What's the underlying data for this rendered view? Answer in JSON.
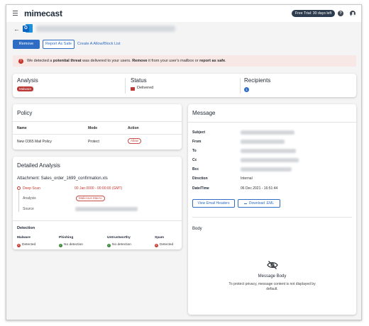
{
  "topbar": {
    "brand": "mimecast",
    "trial_badge": "Free Trial: 30 days left",
    "help_glyph": "?"
  },
  "header": {
    "client_icon": "outlook-icon",
    "outlook_letter": "O"
  },
  "actions": {
    "remove": "Remove",
    "report_safe": "Report As Safe",
    "allow_block": "Create A Allow/Block List"
  },
  "banner": {
    "text_1": "We detected a ",
    "text_2": "potential threat",
    "text_3": " was delivered to your users. ",
    "text_4": "Remove",
    "text_5": " it from your user's mailbox or ",
    "text_6": "report as safe",
    "text_7": "."
  },
  "summary": {
    "analysis_label": "Analysis",
    "analysis_value": "Malware",
    "status_label": "Status",
    "status_value": "Delivered",
    "recipients_label": "Recipients",
    "recipients_count": "1"
  },
  "policy": {
    "title": "Policy",
    "columns": [
      "Name",
      "Mode",
      "Action"
    ],
    "rows": [
      {
        "name": "New O365 Mail Policy",
        "mode": "Protect",
        "action": "Allow"
      }
    ]
  },
  "detailed": {
    "title": "Detailed Analysis",
    "attachment": "Attachment: Sales_order_1699_confirmation.xls",
    "deep_scan": "Deep Scan",
    "deep_scan_time": "00 Jan 0000 - 00:00:00 (GMT)",
    "analysis_label": "Analysis",
    "analysis_value": "Malicious Macro",
    "source_label": "Source",
    "detection_title": "Detection",
    "detection": [
      {
        "name": "Malware",
        "value": "Detected",
        "state": "red"
      },
      {
        "name": "Phishing",
        "value": "No detection",
        "state": "green"
      },
      {
        "name": "Untrustworthy",
        "value": "No detection",
        "state": "green"
      },
      {
        "name": "Spam",
        "value": "Detected",
        "state": "red"
      }
    ]
  },
  "message": {
    "title": "Message",
    "fields": [
      "Subject",
      "From",
      "To",
      "Cc",
      "Bcc",
      "Direction",
      "Date/Time"
    ],
    "direction": "Internal",
    "datetime": "06 Dec 2021 - 16:51:44",
    "view_headers": "View Email Headers",
    "download": "Download .EML",
    "body_label": "Body",
    "body_title": "Message Body",
    "body_note": "To protect privacy, message content is not displayed by default."
  },
  "colors": {
    "accent": "#2f6cc3",
    "danger": "#c8372d",
    "success": "#3a8a3a",
    "banner_bg": "#f7e8e6"
  }
}
